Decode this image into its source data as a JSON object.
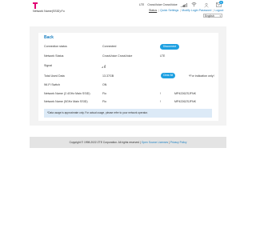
{
  "header": {
    "network_name_label": "Network Name(SSID):Fo",
    "network_type": "LTE",
    "operator": "CrossVoice CrossVoice",
    "mail_count": "0",
    "links": {
      "status": "Status",
      "quick_settings": "Quick Settings",
      "change_password": "Modify Login Password",
      "logout": "Logout"
    },
    "language": "English"
  },
  "main": {
    "back_label": "Back",
    "rows": {
      "connection_status": {
        "label": "Connection status",
        "value": "Connected",
        "button": "Disconnect"
      },
      "network_status": {
        "label": "Network Status",
        "value": "CrossVoice CrossVoice",
        "extra": "LTE"
      },
      "signal": {
        "label": "Signal"
      },
      "total_used_data": {
        "label": "Total Used Data",
        "value": "13.37GB",
        "button": "Clear All",
        "extra": "*For indication only!"
      },
      "wifi_switch": {
        "label": "Wi-Fi Switch",
        "value": "ON"
      },
      "ssid_24": {
        "label": "Network Name (2.4GHz Main SSID)",
        "value": "Flo",
        "extra1": "!",
        "extra2": "MP4226ZSJFNK"
      },
      "ssid_5": {
        "label": "Network Name (5GHz Main SSID)",
        "value": "Flo",
        "extra1": "!",
        "extra2": "MP4226ZSJFNK"
      }
    },
    "note": "*Data usage is approximate only. For actual usage, please refer to your network operator."
  },
  "footer": {
    "copyright": "Copyright © 1998-2022 ZTE Corporation. All rights reserved",
    "open_source": "Open Source Licenses",
    "privacy": "Privacy Policy"
  },
  "colors": {
    "brand": "#e20074",
    "accent": "#1ea0e1",
    "link": "#1a7fc1"
  }
}
